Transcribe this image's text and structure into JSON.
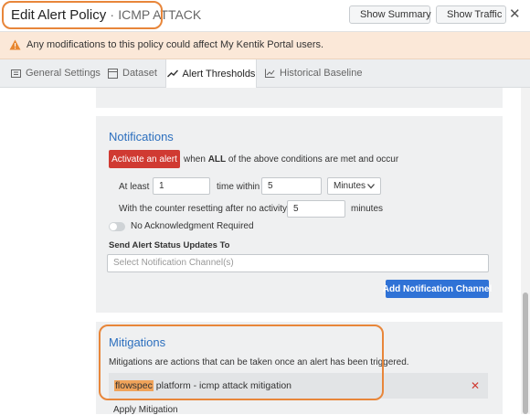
{
  "header": {
    "title": "Edit Alert Policy",
    "separator": "·",
    "subtitle": "ICMP ATTACK",
    "show_summary": "Show Summary",
    "show_traffic": "Show Traffic",
    "close": "✕"
  },
  "warning": {
    "text": "Any modifications to this policy could affect My Kentik Portal users."
  },
  "tabs": [
    {
      "label": "General Settings"
    },
    {
      "label": "Dataset"
    },
    {
      "label": "Alert Thresholds"
    },
    {
      "label": "Historical Baseline"
    }
  ],
  "notifications": {
    "title": "Notifications",
    "activate_button": "Activate an alert",
    "when_prefix": "when",
    "when_all": "ALL",
    "when_suffix": "of the above conditions are met and occur",
    "at_least_label": "At least",
    "at_least_value": "1",
    "time_within_label": "time within",
    "time_within_value": "5",
    "unit_selected": "Minutes",
    "reset_label": "With the counter resetting after no activity for",
    "reset_value": "5",
    "reset_unit": "minutes",
    "ack_label": "No Acknowledgment Required",
    "send_updates_label": "Send Alert Status Updates To",
    "channel_placeholder": "Select Notification Channel(s)",
    "add_channel_button": "Add Notification Channel"
  },
  "mitigations": {
    "title": "Mitigations",
    "description": "Mitigations are actions that can be taken once an alert has been triggered.",
    "item_type": "flowspec",
    "item_rest": "platform - icmp attack mitigation",
    "remove": "✕",
    "apply_label": "Apply Mitigation"
  },
  "colors": {
    "accent": "#2c6fbe",
    "danger": "#d03a32",
    "primary": "#2f72d6",
    "highlight": "#e8863a"
  },
  "icons": [
    "gear-icon",
    "dataset-icon",
    "trend-icon",
    "chart-icon",
    "warning-icon",
    "close-icon",
    "chevron-down-icon"
  ]
}
